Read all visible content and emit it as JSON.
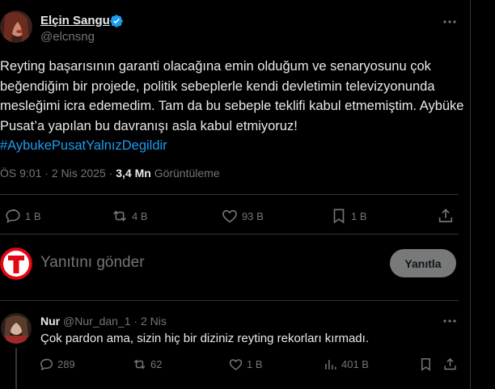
{
  "tweet": {
    "display_name": "Elçin Sangu",
    "handle": "@elcnsng",
    "text": "Reyting başarısının garanti olacağına emin olduğum ve senaryosunu çok beğendiğim  bir projede, politik sebeplerle kendi devletimin televizyonunda mesleğimi icra edemedim. Tam da bu sebeple teklifi kabul etmemiştim. Aybüke Pusat’a yapılan bu davranışı asla kabul etmiyoruz!",
    "hashtag": "#AybukePusatYalnızDegildir",
    "time": "ÖS 9:01",
    "date": "2 Nis 2025",
    "views_count": "3,4 Mn",
    "views_label": "Görüntüleme",
    "stats": {
      "replies": "1 B",
      "reposts": "4 B",
      "likes": "93 B",
      "bookmarks": "1 B"
    },
    "icons": [
      "verified-badge-icon",
      "more-icon",
      "reply-icon",
      "repost-icon",
      "like-icon",
      "bookmark-icon",
      "share-icon"
    ],
    "colors": {
      "accent": "#1d9bf0",
      "background": "#000000",
      "muted": "#71767b"
    }
  },
  "compose": {
    "placeholder": "Yanıtını gönder",
    "button_label": "Yanıtla",
    "logo_letter": "T",
    "logo_color": "#e30613"
  },
  "reply": {
    "display_name": "Nur",
    "handle": "@Nur_dan_1",
    "time": "2 Nis",
    "text": "Çok pardon ama, sizin hiç bir diziniz reyting rekorları kırmadı.",
    "stats": {
      "replies": "289",
      "reposts": "62",
      "likes": "1 B",
      "views": "401 B"
    }
  }
}
